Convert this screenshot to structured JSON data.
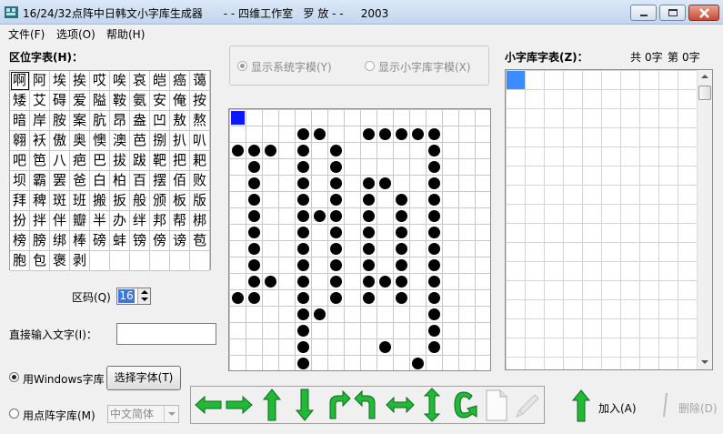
{
  "window": {
    "title": "16/24/32点阵中日韩文小字库生成器      - - 四维工作室   罗 放 - -     2003"
  },
  "menu": {
    "items": [
      "文件(F)",
      "选项(O)",
      "帮助(H)"
    ]
  },
  "char_table": {
    "label": "区位字表(H)：",
    "rows": [
      [
        "啊",
        "阿",
        "埃",
        "挨",
        "哎",
        "唉",
        "哀",
        "皑",
        "癌",
        "蔼"
      ],
      [
        "矮",
        "艾",
        "碍",
        "爱",
        "隘",
        "鞍",
        "氨",
        "安",
        "俺",
        "按"
      ],
      [
        "暗",
        "岸",
        "胺",
        "案",
        "肮",
        "昂",
        "盎",
        "凹",
        "敖",
        "熬"
      ],
      [
        "翱",
        "袄",
        "傲",
        "奥",
        "懊",
        "澳",
        "芭",
        "捌",
        "扒",
        "叭"
      ],
      [
        "吧",
        "笆",
        "八",
        "疤",
        "巴",
        "拔",
        "跋",
        "靶",
        "把",
        "耙"
      ],
      [
        "坝",
        "霸",
        "罢",
        "爸",
        "白",
        "柏",
        "百",
        "摆",
        "佰",
        "败"
      ],
      [
        "拜",
        "稗",
        "斑",
        "班",
        "搬",
        "扳",
        "般",
        "颁",
        "板",
        "版"
      ],
      [
        "扮",
        "拌",
        "伴",
        "瓣",
        "半",
        "办",
        "绊",
        "邦",
        "帮",
        "梆"
      ],
      [
        "榜",
        "膀",
        "绑",
        "棒",
        "磅",
        "蚌",
        "镑",
        "傍",
        "谤",
        "苞"
      ],
      [
        "胞",
        "包",
        "褒",
        "剥",
        "",
        "",
        "",
        "",
        "",
        ""
      ]
    ]
  },
  "code": {
    "label": "区码(Q)",
    "value": "16"
  },
  "direct_input": {
    "label": "直接输入文字(I)：",
    "value": ""
  },
  "font_source": {
    "use_windows_label": "用Windows字库",
    "use_bitmap_label": "用点阵字库(M)",
    "choose_font_label": "选择字体(T)",
    "charset_value": "中文简体"
  },
  "glyph_mode": {
    "system_label": "显示系统字模(Y)",
    "small_label": "显示小字库字模(X)"
  },
  "glyph": {
    "size": 16,
    "cursor": [
      0,
      0
    ],
    "pixels": [
      "................",
      "....XX..XXXXX...",
      "XXX.X.X.....X...",
      ".X..X.X.....X...",
      ".X..X.X.XX..X...",
      ".X..X.X.X.X.X...",
      ".X..XXX.X.X.X...",
      ".X..X.X.X.X.X...",
      ".X..X.X.X.X.X...",
      ".X..X.X.X.X.X...",
      ".XX.X.X.XXX.X...",
      "XX..X.X.X.X.X...",
      "....XX......X...",
      "....X.......X...",
      "....X....X..X...",
      "....X......X...."
    ]
  },
  "small_table": {
    "label": "小字库字表(Z)：",
    "total_label": "共",
    "total_value": "0字",
    "page_label": "第",
    "page_value": "0字"
  },
  "actions": {
    "add_label": "加入(A)",
    "delete_label": "删除(D)"
  },
  "colors": {
    "arrow_green": "#22b838",
    "selection_blue": "#3b8cff"
  }
}
